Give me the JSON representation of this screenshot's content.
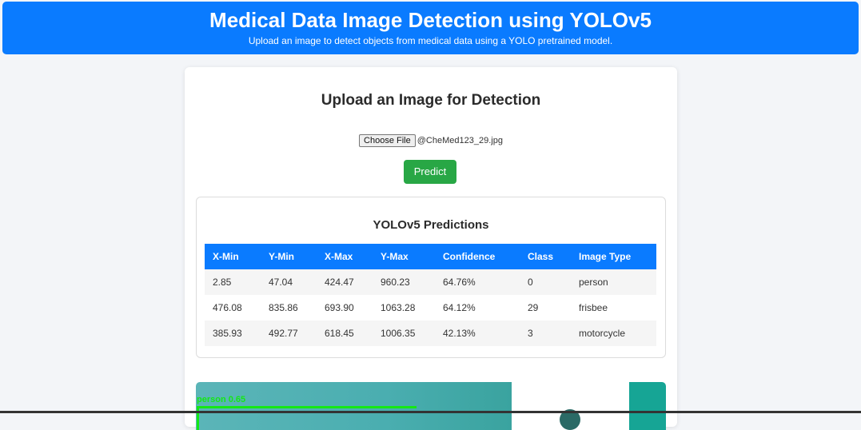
{
  "header": {
    "title": "Medical Data Image Detection using YOLOv5",
    "subtitle": "Upload an image to detect objects from medical data using a YOLO pretrained model."
  },
  "upload": {
    "heading": "Upload an Image for Detection",
    "choose_file_label": "Choose File",
    "file_name": "@CheMed123_29.jpg",
    "predict_label": "Predict"
  },
  "predictions": {
    "heading": "YOLOv5 Predictions",
    "columns": [
      "X-Min",
      "Y-Min",
      "X-Max",
      "Y-Max",
      "Confidence",
      "Class",
      "Image Type"
    ],
    "rows": [
      [
        "2.85",
        "47.04",
        "424.47",
        "960.23",
        "64.76%",
        "0",
        "person"
      ],
      [
        "476.08",
        "835.86",
        "693.90",
        "1063.28",
        "64.12%",
        "29",
        "frisbee"
      ],
      [
        "385.93",
        "492.77",
        "618.45",
        "1006.35",
        "42.13%",
        "3",
        "motorcycle"
      ]
    ]
  },
  "result_image": {
    "detection_label": "person 0.65",
    "box_color": "#15e815"
  },
  "colors": {
    "primary": "#0a7bff",
    "success": "#28a745"
  }
}
